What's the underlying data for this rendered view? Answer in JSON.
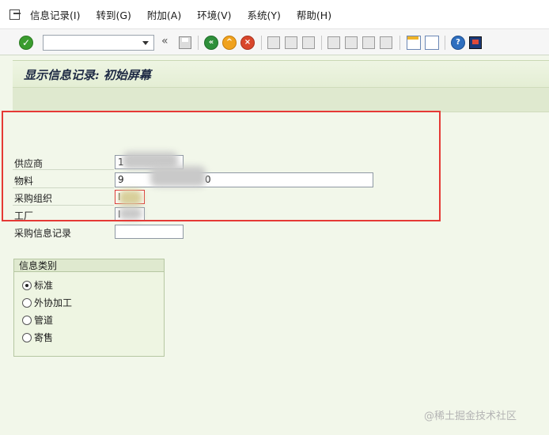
{
  "menubar": {
    "items": [
      {
        "label": "信息记录(I)"
      },
      {
        "label": "转到(G)"
      },
      {
        "label": "附加(A)"
      },
      {
        "label": "环境(V)"
      },
      {
        "label": "系统(Y)"
      },
      {
        "label": "帮助(H)"
      }
    ]
  },
  "toolbar": {
    "command_field_value": "",
    "collapse_symbol": "«",
    "enter_symbol": "✓",
    "back_symbol": "«",
    "exit_symbol": "^",
    "cancel_symbol": "×",
    "help_symbol": "?"
  },
  "screen": {
    "title": "显示信息记录: 初始屏幕"
  },
  "form": {
    "vendor": {
      "label": "供应商",
      "value": "1"
    },
    "material": {
      "label": "物料",
      "value": "9",
      "value_tail": "0"
    },
    "purch_org": {
      "label": "采购组织",
      "value": "I"
    },
    "plant": {
      "label": "工厂",
      "value": "I"
    },
    "info_record": {
      "label": "采购信息记录",
      "value": ""
    }
  },
  "info_category": {
    "title": "信息类别",
    "options": [
      {
        "label": "标准",
        "selected": true
      },
      {
        "label": "外协加工",
        "selected": false
      },
      {
        "label": "管道",
        "selected": false
      },
      {
        "label": "寄售",
        "selected": false
      }
    ]
  },
  "watermark": "@稀土掘金技术社区",
  "colors": {
    "background": "#f2f7ea",
    "title_band": "#e4eed4",
    "highlight_border": "#e53935"
  }
}
